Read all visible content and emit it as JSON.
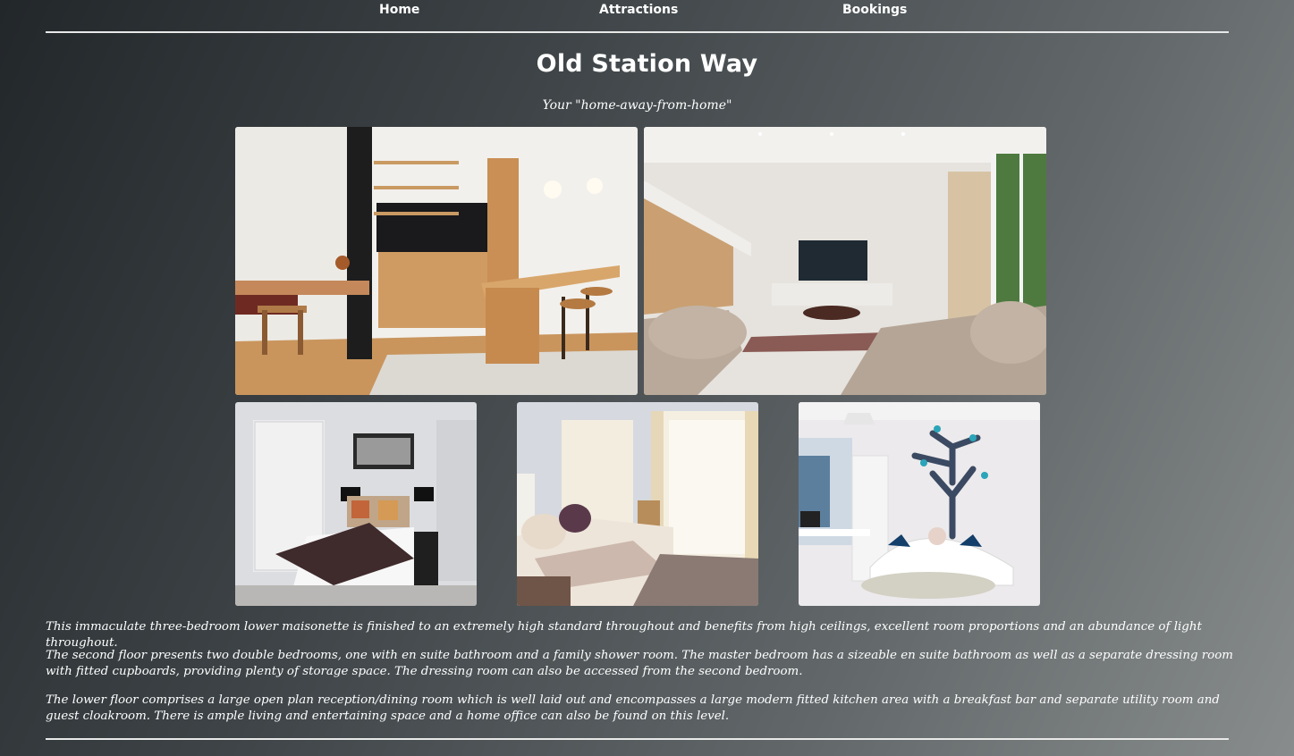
{
  "nav": {
    "items": [
      {
        "label": "Home"
      },
      {
        "label": "Attractions"
      },
      {
        "label": "Bookings"
      }
    ]
  },
  "page": {
    "title": "Old Station Way",
    "subtitle": "Your \"home-away-from-home\""
  },
  "gallery": {
    "images": [
      {
        "subject": "kitchen"
      },
      {
        "subject": "living-room"
      },
      {
        "subject": "bedroom"
      },
      {
        "subject": "guest-bedroom"
      },
      {
        "subject": "childrens-room"
      }
    ]
  },
  "description": {
    "paragraphs": [
      "This immaculate three-bedroom lower maisonette is finished to an extremely high standard throughout and benefits from high ceilings, excellent room proportions and an abundance of light throughout.",
      "The second floor presents two double bedrooms, one with en suite bathroom and a family shower room. The master bedroom has a sizeable en suite bathroom as well as a separate dressing room with fitted cupboards, providing plenty of storage space. The dressing room can also be accessed from the second bedroom.",
      "The lower floor comprises a large open plan reception/dining room which is well laid out and encompasses a large modern fitted kitchen area with a breakfast bar and separate utility room and guest cloakroom. There is ample living and entertaining space and a home office can also be found on this level."
    ]
  }
}
